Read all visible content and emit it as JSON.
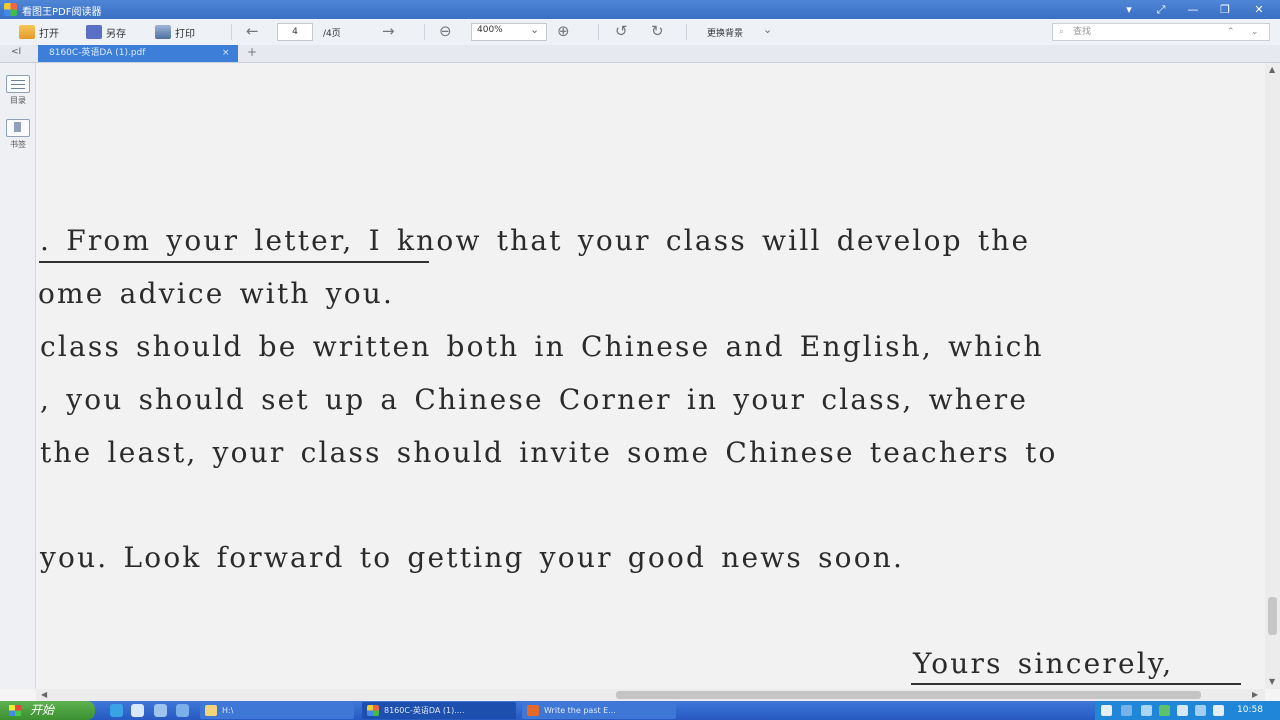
{
  "window": {
    "title": "看图王PDF阅读器",
    "controls": [
      "▾",
      "⤢",
      "—",
      "❐",
      "✕"
    ]
  },
  "toolbar": {
    "open_label": "打开",
    "saveas_label": "另存",
    "print_label": "打印",
    "prev_page": "←",
    "current_page": "4",
    "total_pages": "/4页",
    "next_page": "→",
    "zoom_out": "⊖",
    "zoom_value": "400%",
    "zoom_dropdown": "⌄",
    "zoom_in": "⊕",
    "rotate_left": "↺",
    "rotate_right": "↻",
    "background_label": "更换背景",
    "background_dropdown": "⌄",
    "search_placeholder": "查找",
    "search_up": "⌃",
    "search_down": "⌄"
  },
  "tabs": {
    "toggle": "<I",
    "items": [
      {
        "label": "8160C-英语DA (1).pdf",
        "close": "×",
        "active": true
      }
    ],
    "add": "+"
  },
  "left_panel": {
    "toc_label": "目录",
    "bookmark_label": "书签"
  },
  "document": {
    "lines": [
      ". From your letter, I know that your class will develop the",
      "ome advice with you.",
      " class should be written both in Chinese and English, which",
      ", you should set up a Chinese Corner in your class, where",
      " the least, your class should invite some Chinese teachers to",
      " you. Look forward to getting your good news soon.",
      "Yours sincerely,"
    ]
  },
  "scrollbar": {
    "up": "▲",
    "down": "▼",
    "left": "◀",
    "right": "▶"
  },
  "taskbar": {
    "start_label": "开始",
    "tasks": [
      {
        "label": "H:\\"
      },
      {
        "label": "8160C-英语DA (1)...."
      },
      {
        "label": "Write the past E..."
      }
    ],
    "clock": "10:58"
  },
  "colors": {
    "title_bar": "#3a6fc4",
    "active_tab": "#3d7fd8",
    "taskbar": "#2759c1",
    "start_button": "#3a8f31",
    "page_background": "#f2f2f2"
  }
}
